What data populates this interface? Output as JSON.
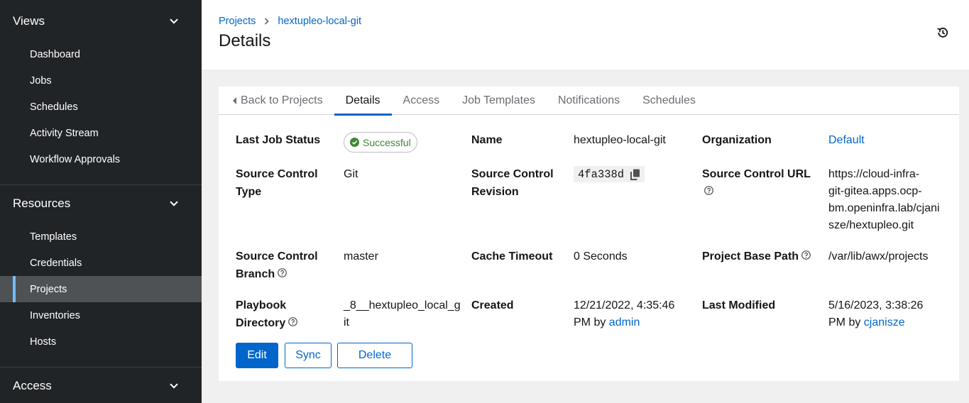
{
  "sidebar": {
    "groups": [
      {
        "label": "Views",
        "items": [
          "Dashboard",
          "Jobs",
          "Schedules",
          "Activity Stream",
          "Workflow Approvals"
        ]
      },
      {
        "label": "Resources",
        "items": [
          "Templates",
          "Credentials",
          "Projects",
          "Inventories",
          "Hosts"
        ]
      },
      {
        "label": "Access"
      }
    ],
    "active_item": "Projects"
  },
  "header": {
    "breadcrumb": [
      "Projects",
      "hextupleo-local-git"
    ],
    "title": "Details"
  },
  "tabs": [
    "Back to Projects",
    "Details",
    "Access",
    "Job Templates",
    "Notifications",
    "Schedules"
  ],
  "active_tab": "Details",
  "details": {
    "last_job_status": {
      "label": "Last Job Status",
      "value": "Successful"
    },
    "name": {
      "label": "Name",
      "value": "hextupleo-local-git"
    },
    "organization": {
      "label": "Organization",
      "value": "Default"
    },
    "source_control_type": {
      "label_l1": "Source Control",
      "label_l2": "Type",
      "value": "Git"
    },
    "source_control_revision": {
      "label_l1": "Source Control",
      "label_l2": "Revision",
      "value": "4fa338d"
    },
    "source_control_url": {
      "label": "Source Control URL",
      "value_lines": [
        "https://cloud-infra-",
        "git-gitea.apps.ocp-",
        "bm.openinfra.lab/cjani",
        "sze/hextupleo.git"
      ]
    },
    "source_control_branch": {
      "label_l1": "Source Control",
      "label_l2": "Branch",
      "value": "master"
    },
    "cache_timeout": {
      "label": "Cache Timeout",
      "value": "0 Seconds"
    },
    "project_base_path": {
      "label": "Project Base Path",
      "value": "/var/lib/awx/projects"
    },
    "playbook_directory": {
      "label_l1": "Playbook",
      "label_l2": "Directory",
      "value_l1": "_8__hextupleo_local_g",
      "value_l2": "it"
    },
    "created": {
      "label": "Created",
      "value_l1": "12/21/2022, 4:35:46",
      "value_l2_prefix": "PM by ",
      "user": "admin"
    },
    "last_modified": {
      "label": "Last Modified",
      "value_l1": "5/16/2023, 3:38:26",
      "value_l2_prefix": "PM by ",
      "user": "cjanisze"
    }
  },
  "actions": {
    "edit": "Edit",
    "sync": "Sync",
    "delete": "Delete"
  },
  "colors": {
    "sidebar_bg": "#212427",
    "link": "#0066cc",
    "success": "#3e8635",
    "active_indicator": "#73bcf7"
  },
  "icons": {
    "chevron": "chevron-down-icon",
    "history": "history-icon",
    "help": "question-circle-icon",
    "copy": "copy-icon",
    "status": "check-circle-icon"
  }
}
